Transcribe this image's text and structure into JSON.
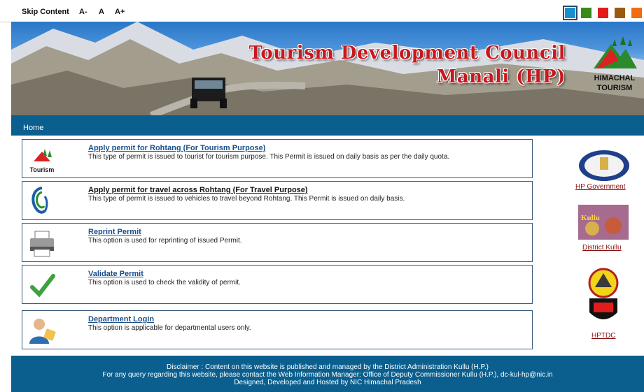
{
  "topbar": {
    "skip_label": "Skip Content",
    "font_decrease": "A-",
    "font_normal": "A",
    "font_increase": "A+",
    "themes": [
      "#1a8fd0",
      "#3a8a18",
      "#e31b1b",
      "#9b5a12",
      "#f36b10"
    ]
  },
  "banner": {
    "title_line1": "Tourism Development Council",
    "title_line2": "Manali (HP)",
    "logo_line1": "HIMACHAL",
    "logo_line2": "TOURISM"
  },
  "nav": {
    "home": "Home"
  },
  "services": [
    {
      "title": "Apply permit for Rohtang (For Tourism Purpose)",
      "desc": "This type of permit is issued to tourist for tourism purpose. This Permit is issued on daily basis as per the daily quota.",
      "icon_label": "Tourism"
    },
    {
      "title": "Apply permit for travel across Rohtang (For Travel Purpose)",
      "desc": "This type of permit is issued to vehicles to travel beyond Rohtang. This Permit is issued on daily basis."
    },
    {
      "title": "Reprint Permit",
      "desc": "This option is used for reprinting of issued Permit."
    },
    {
      "title": "Validate Permit",
      "desc": "This option is used to check the validity of permit."
    },
    {
      "title": "Department Login",
      "desc": "This option is applicable for departmental users only."
    }
  ],
  "sidebar": {
    "hp_government": "HP Government",
    "district_kullu": "District Kullu",
    "kullu_tile_text": "Kullu",
    "hptdc": "HPTDC"
  },
  "footer": {
    "line1": "Disclaimer : Content on this website is published and managed by the District Administration Kullu (H.P.)",
    "line2": "For any query regarding this website, please contact the Web Information Manager: Office of Deputy Commissioner Kullu (H.P.), dc-kul-hp@nic.in",
    "line3": "Designed, Developed and Hosted by NIC Himachal Pradesh"
  }
}
